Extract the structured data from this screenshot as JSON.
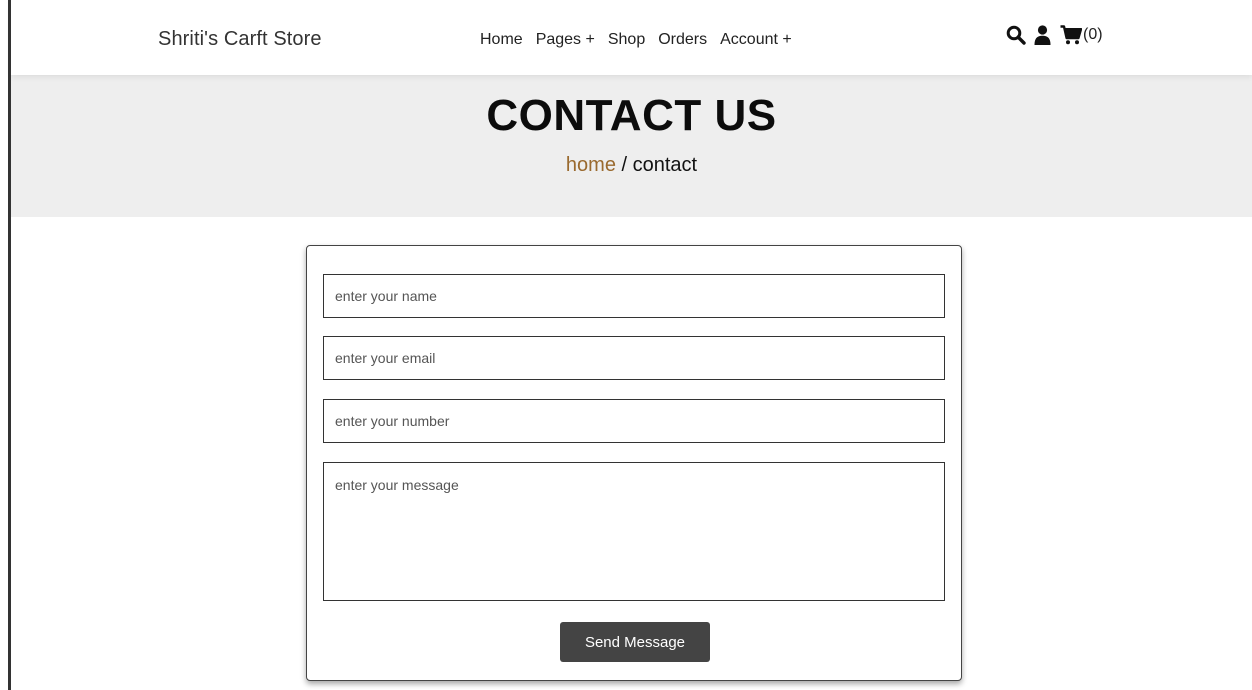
{
  "header": {
    "logo": "Shriti's Carft Store",
    "nav": [
      "Home",
      "Pages +",
      "Shop",
      "Orders",
      "Account +"
    ],
    "icons": [
      "search-icon",
      "user-icon",
      "cart-icon"
    ],
    "cart_count": "(0)"
  },
  "banner": {
    "title": "CONTACT US",
    "breadcrumb_home": "home",
    "breadcrumb_sep": " / ",
    "breadcrumb_current": "contact"
  },
  "form": {
    "name_placeholder": "enter your name",
    "email_placeholder": "enter your email",
    "number_placeholder": "enter your number",
    "message_placeholder": "enter your message",
    "submit_label": "Send Message"
  },
  "colors": {
    "breadcrumb_accent": "#9a6a2f",
    "button_bg": "#444444",
    "banner_bg": "#eeeeee"
  }
}
